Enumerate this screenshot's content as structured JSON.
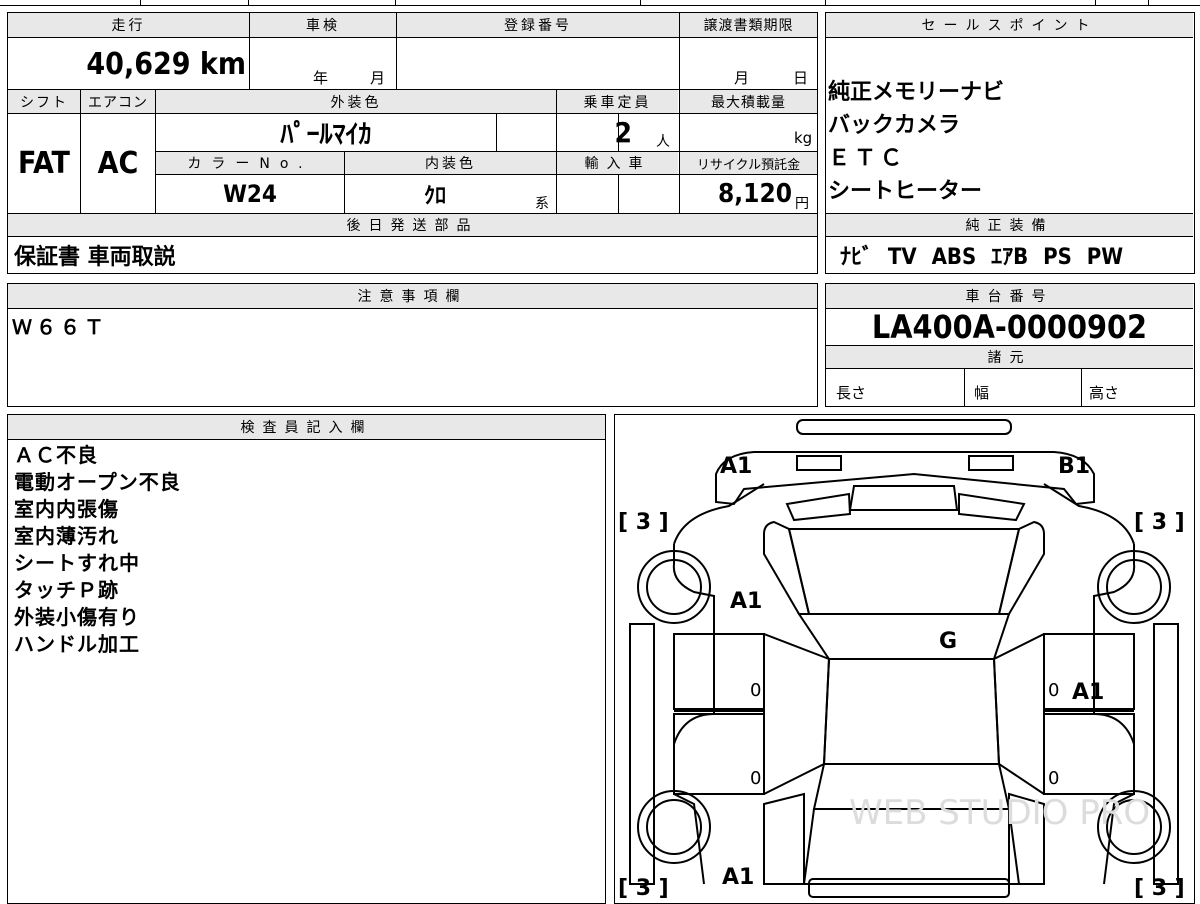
{
  "vehicle": {
    "mileage_label": "走行",
    "mileage_value": "40,629 km",
    "inspection_label": "車検",
    "inspection_year_unit": "年",
    "inspection_month_unit": "月",
    "registration_label": "登録番号",
    "transfer_label": "譲渡書類期限",
    "transfer_month_unit": "月",
    "transfer_day_unit": "日",
    "shift_label": "シフト",
    "shift_value": "FAT",
    "aircon_label": "エアコン",
    "aircon_value": "AC",
    "exterior_label": "外装色",
    "exterior_value": "ﾊﾟｰﾙﾏｲｶ",
    "capacity_label": "乗車定員",
    "capacity_value": "2",
    "capacity_unit": "人",
    "max_load_label": "最大積載量",
    "max_load_unit": "kg",
    "color_no_label": "カラーNo.",
    "color_no_value": "W24",
    "interior_label": "内装色",
    "interior_value": "ｸﾛ",
    "interior_unit": "系",
    "import_label": "輸入車",
    "recycle_label": "リサイクル預託金",
    "recycle_value": "8,120",
    "recycle_unit": "円",
    "later_parts_label": "後日発送部品",
    "later_parts_value": "保証書 車両取説"
  },
  "sales_points": {
    "label": "セールスポイント",
    "items": [
      "純正メモリーナビ",
      "バックカメラ",
      "ＥＴＣ",
      "シートヒーター"
    ]
  },
  "equipment": {
    "label": "純正装備",
    "value": "ﾅﾋﾞ TV ABS ｴｱB PS PW"
  },
  "notes": {
    "label": "注意事項欄",
    "value": "Ｗ６６Ｔ"
  },
  "chassis": {
    "label": "車台番号",
    "value": "LA400A-0000902",
    "specs_label": "諸元",
    "length_label": "長さ",
    "width_label": "幅",
    "height_label": "高さ"
  },
  "inspector": {
    "label": "検査員記入欄",
    "lines": [
      "ＡＣ不良",
      "電動オープン不良",
      "室内内張傷",
      "室内薄汚れ",
      "シートすれ中",
      "タッチＰ跡",
      "外装小傷有り",
      "ハンドル加工"
    ]
  },
  "diagram": {
    "front_left": "A1",
    "front_right": "B1",
    "tire_fl": "[ 3 ]",
    "tire_fr": "[ 3 ]",
    "tire_rl": "[ 3 ]",
    "tire_rr": "[ 3 ]",
    "left_fender": "A1",
    "windshield": "G",
    "right_door": "A1",
    "rear_left": "A1",
    "door_fl_mark": "0",
    "door_rl_mark": "0",
    "door_fr_mark": "0",
    "door_rr_mark": "0"
  }
}
